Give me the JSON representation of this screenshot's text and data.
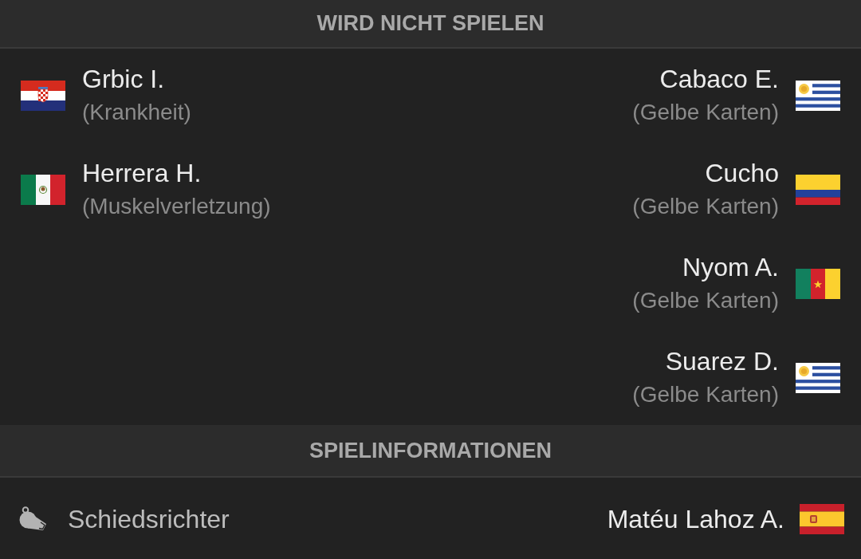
{
  "absences": {
    "title": "WIRD NICHT SPIELEN",
    "home": [
      {
        "name": "Grbic I.",
        "reason": "(Krankheit)",
        "flag": {
          "kind": "croatia"
        }
      },
      {
        "name": "Herrera H.",
        "reason": "(Muskelverletzung)",
        "flag": {
          "kind": "mexico"
        }
      }
    ],
    "away": [
      {
        "name": "Cabaco E.",
        "reason": "(Gelbe Karten)",
        "flag": {
          "kind": "uruguay"
        }
      },
      {
        "name": "Cucho",
        "reason": "(Gelbe Karten)",
        "flag": {
          "kind": "colombia"
        }
      },
      {
        "name": "Nyom A.",
        "reason": "(Gelbe Karten)",
        "flag": {
          "kind": "cameroon"
        }
      },
      {
        "name": "Suarez D.",
        "reason": "(Gelbe Karten)",
        "flag": {
          "kind": "uruguay"
        }
      }
    ]
  },
  "match_info": {
    "title": "SPIELINFORMATIONEN",
    "rows": [
      {
        "kind": "referee",
        "label": "Schiedsrichter",
        "value": "Matéu Lahoz A.",
        "flag": {
          "kind": "spain"
        }
      }
    ]
  }
}
